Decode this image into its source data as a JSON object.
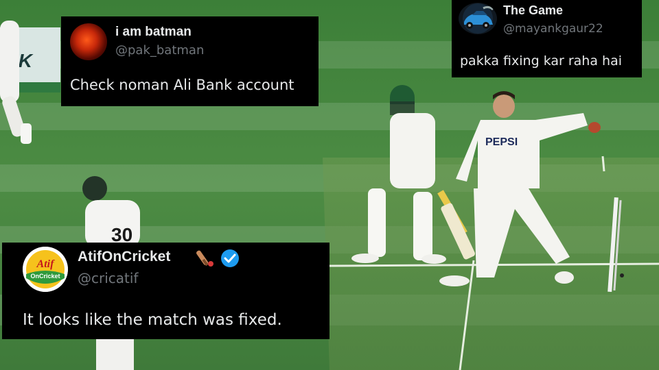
{
  "scene": {
    "kit_logo": "PEPSI",
    "shirt_number": "30"
  },
  "tweets": [
    {
      "display_name": "i am batman",
      "handle": "@pak_batman",
      "text": "Check noman Ali Bank account",
      "avatar_icon": "fire-avatar-icon"
    },
    {
      "display_name": "The Game",
      "handle": "@mayankgaur22",
      "text": "pakka fixing kar raha hai",
      "avatar_icon": "car-avatar-icon"
    },
    {
      "display_name": "AtifOnCricket",
      "handle": "@cricatif",
      "text": "It looks like the match was fixed.",
      "avatar_icon": "atif-on-cricket-logo-icon",
      "badges": [
        "cricket-bat-emoji-icon",
        "verified-badge-icon"
      ],
      "avatar_logo_text": "AtifOnCricket"
    }
  ],
  "colors": {
    "tweet_bg": "#000000",
    "name_text": "#e7e9ea",
    "handle_text": "#71767b",
    "verified_blue": "#1d9bf0",
    "pitch_green": "#4f8a45"
  }
}
